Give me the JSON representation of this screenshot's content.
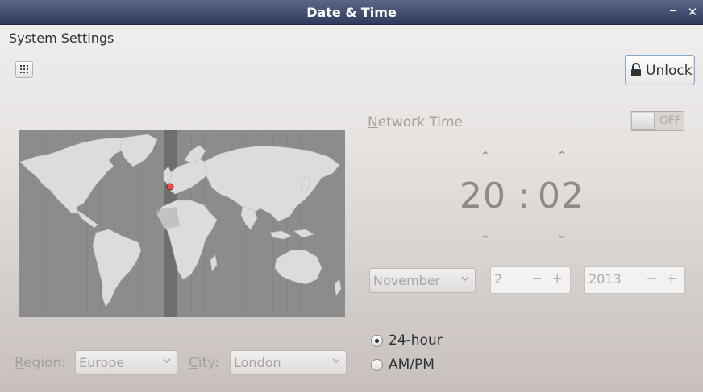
{
  "window": {
    "title": "Date & Time"
  },
  "breadcrumb": "System Settings",
  "toolbar": {
    "unlock_label": "Unlock"
  },
  "network_time": {
    "label_accel": "N",
    "label_rest": "etwork Time",
    "toggle_state": "OFF"
  },
  "time": {
    "hours": "20",
    "separator": ":",
    "minutes": "02"
  },
  "date": {
    "month": "November",
    "day": "2",
    "year": "2013"
  },
  "spin": {
    "minus": "−",
    "plus": "+"
  },
  "location": {
    "region_accel": "R",
    "region_rest": "egion:",
    "region_value": "Europe",
    "city_accel": "C",
    "city_rest": "ity:",
    "city_value": "London"
  },
  "format": {
    "option_24h": "24-hour",
    "option_ampm": "AM/PM",
    "selected": "24-hour"
  },
  "colors": {
    "titlebar": "#3d4769",
    "accent_border": "#7fa7cf",
    "marker": "#e84c4c"
  }
}
